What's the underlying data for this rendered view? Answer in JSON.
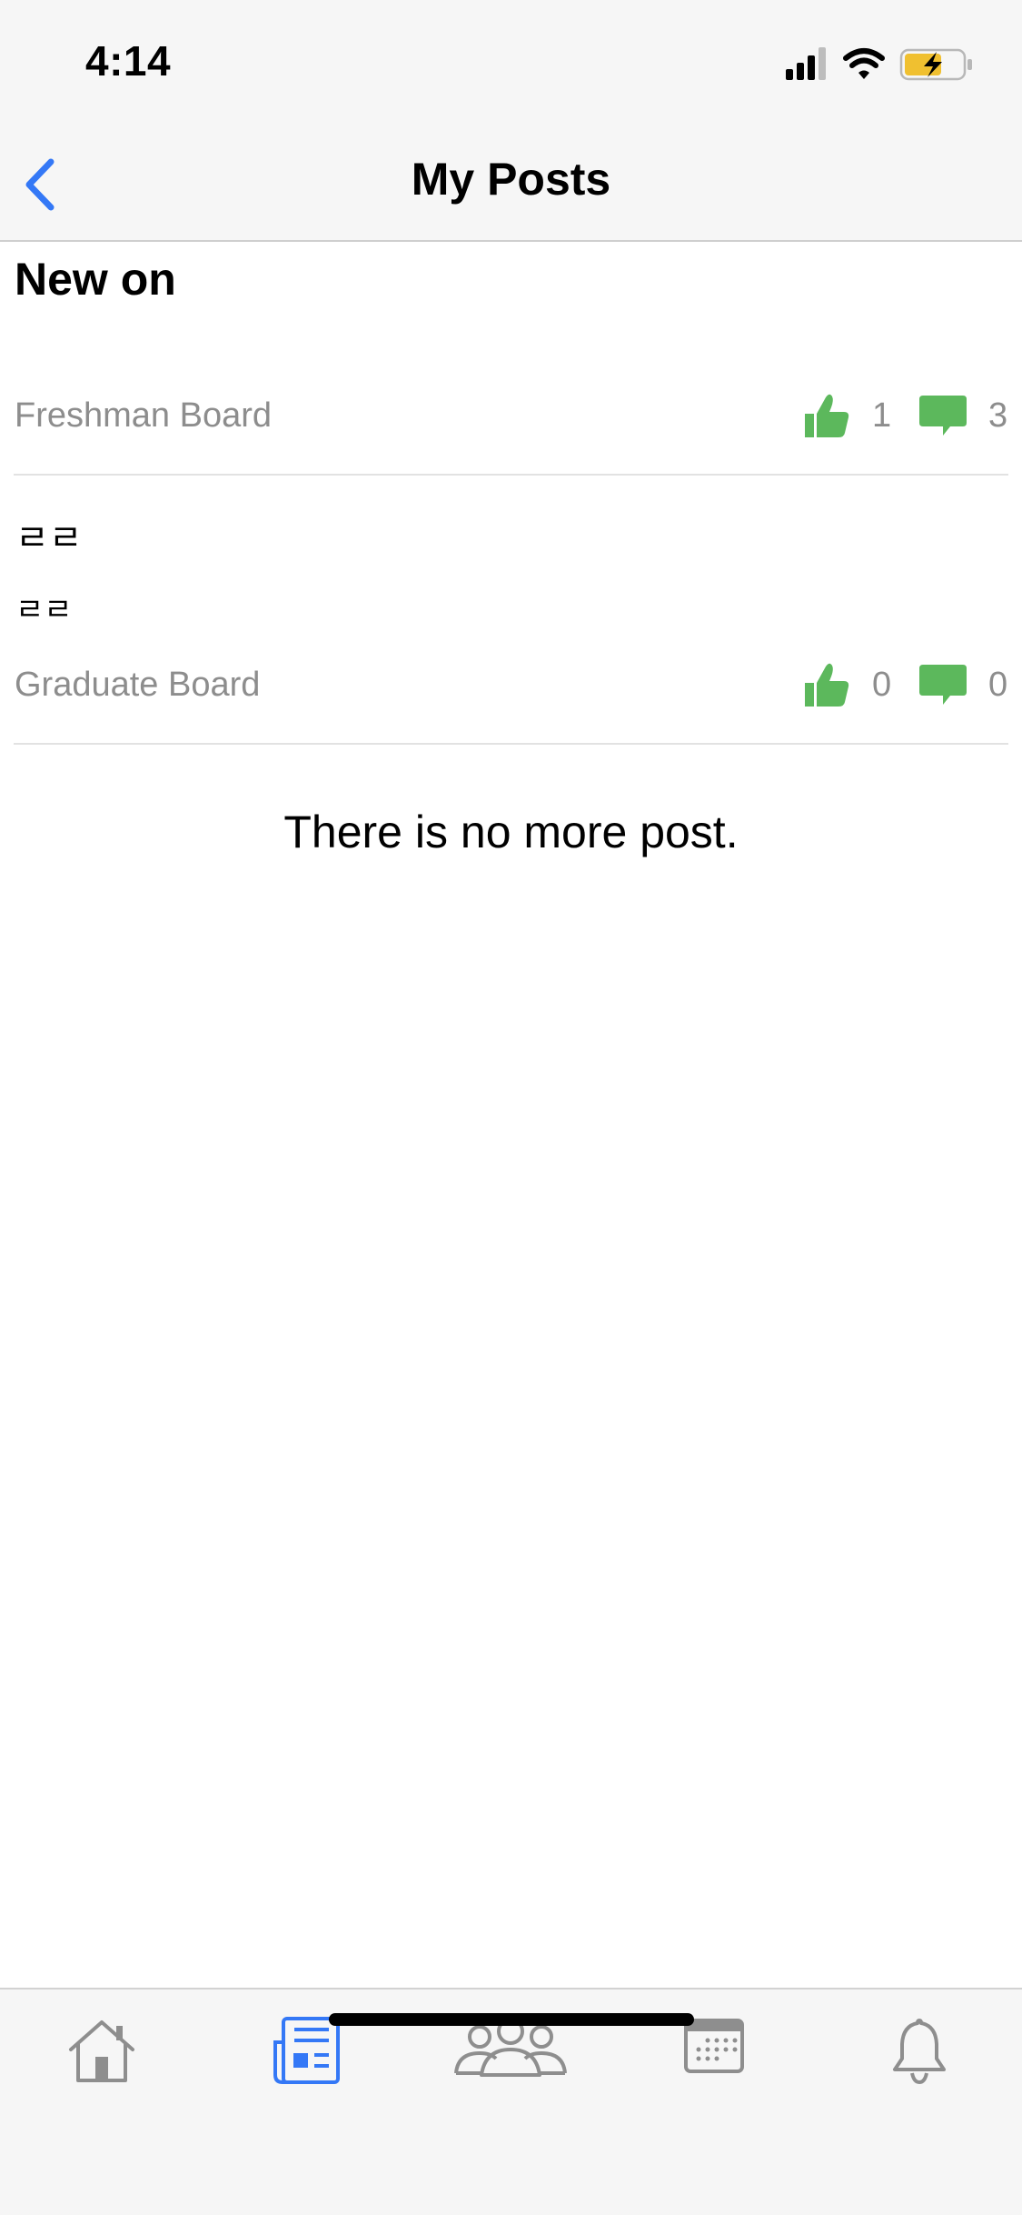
{
  "status_bar": {
    "time": "4:14"
  },
  "nav": {
    "title": "My Posts",
    "back_icon": "chevron-left-icon"
  },
  "posts": [
    {
      "title": "New on",
      "board": "Freshman Board",
      "likes": "1",
      "comments": "3"
    },
    {
      "text_a": "ㄹㄹ",
      "text_b": "ㄹㄹ",
      "board": "Graduate Board",
      "likes": "0",
      "comments": "0"
    }
  ],
  "footer_message": "There is no more post.",
  "tabs": [
    {
      "name": "home",
      "icon": "home-icon",
      "active": false
    },
    {
      "name": "board",
      "icon": "newspaper-icon",
      "active": true
    },
    {
      "name": "people",
      "icon": "people-icon",
      "active": false
    },
    {
      "name": "calendar",
      "icon": "calendar-icon",
      "active": false
    },
    {
      "name": "notifications",
      "icon": "bell-icon",
      "active": false
    }
  ],
  "colors": {
    "accent": "#3478f6",
    "stat_green": "#5cb85c",
    "muted_text": "#8d8d8d",
    "tab_inactive": "#8e8e8e"
  }
}
